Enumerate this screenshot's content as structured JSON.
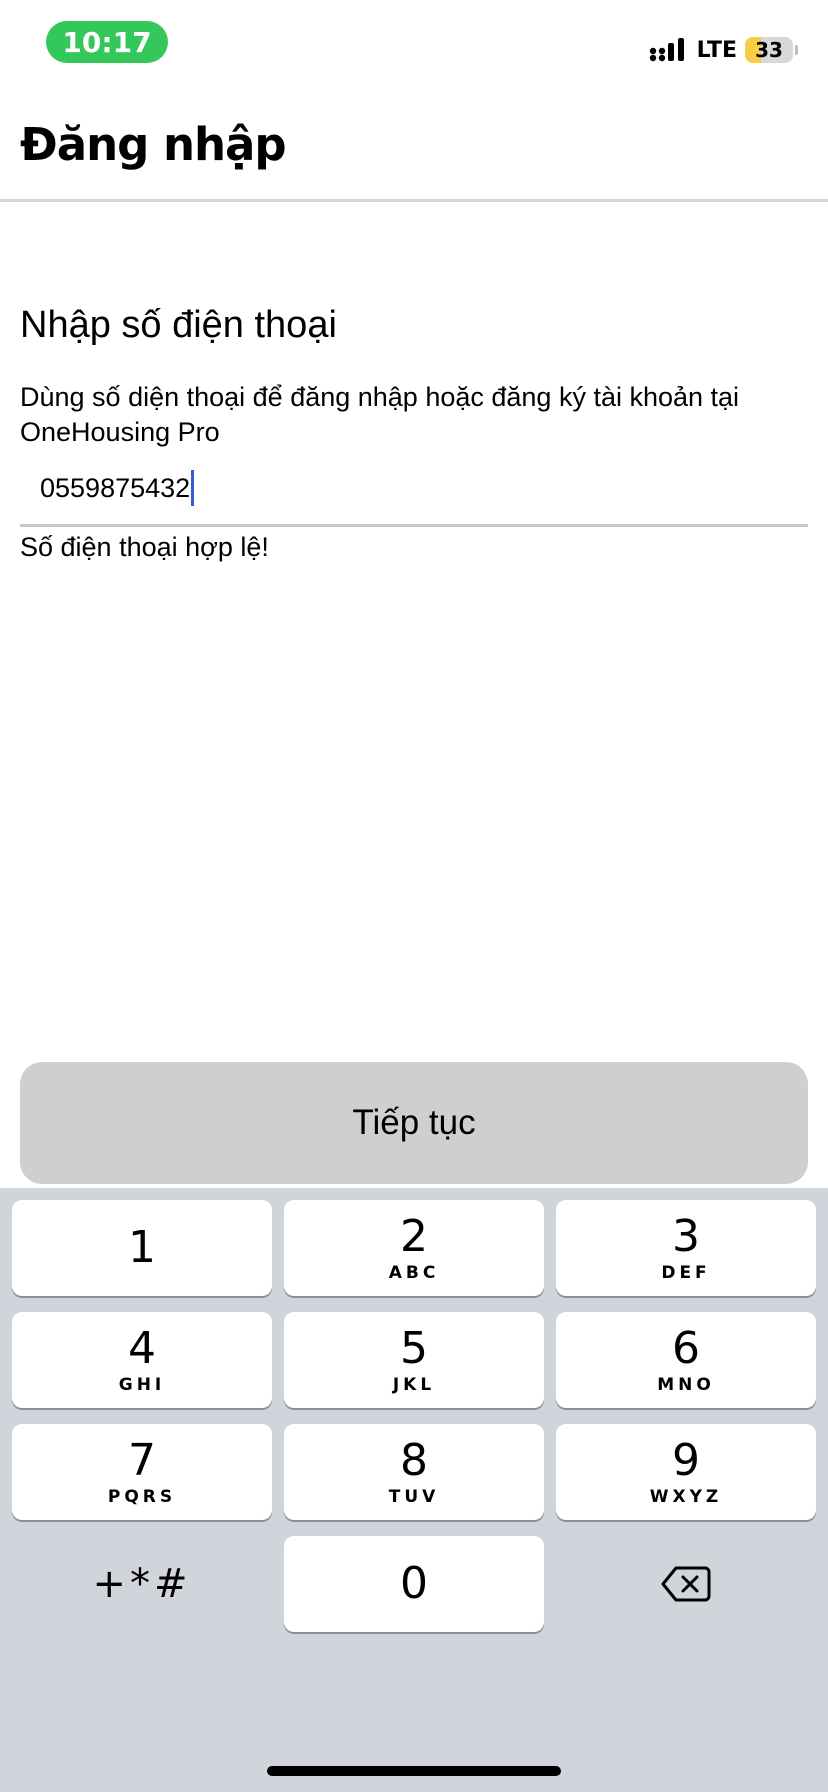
{
  "status_bar": {
    "time": "10:17",
    "network": "LTE",
    "battery_percent": "33",
    "battery_level": 0.33,
    "time_pill_color": "#34c759",
    "battery_color": "#f7ce46"
  },
  "header": {
    "title": "Đăng nhập"
  },
  "login": {
    "section_title": "Nhập số điện thoại",
    "description": "Dùng số diện thoại để đăng nhập hoặc đăng ký tài khoản tại OneHousing Pro",
    "phone_value": "0559875432",
    "validation_message": "Số điện thoại hợp lệ!",
    "continue_label": "Tiếp tục"
  },
  "keyboard": {
    "keys": [
      {
        "digit": "1",
        "letters": ""
      },
      {
        "digit": "2",
        "letters": "ABC"
      },
      {
        "digit": "3",
        "letters": "DEF"
      },
      {
        "digit": "4",
        "letters": "GHI"
      },
      {
        "digit": "5",
        "letters": "JKL"
      },
      {
        "digit": "6",
        "letters": "MNO"
      },
      {
        "digit": "7",
        "letters": "PQRS"
      },
      {
        "digit": "8",
        "letters": "TUV"
      },
      {
        "digit": "9",
        "letters": "WXYZ"
      },
      {
        "digit": "0",
        "letters": ""
      }
    ],
    "symbols": "+*#",
    "delete_icon": "backspace-icon"
  }
}
